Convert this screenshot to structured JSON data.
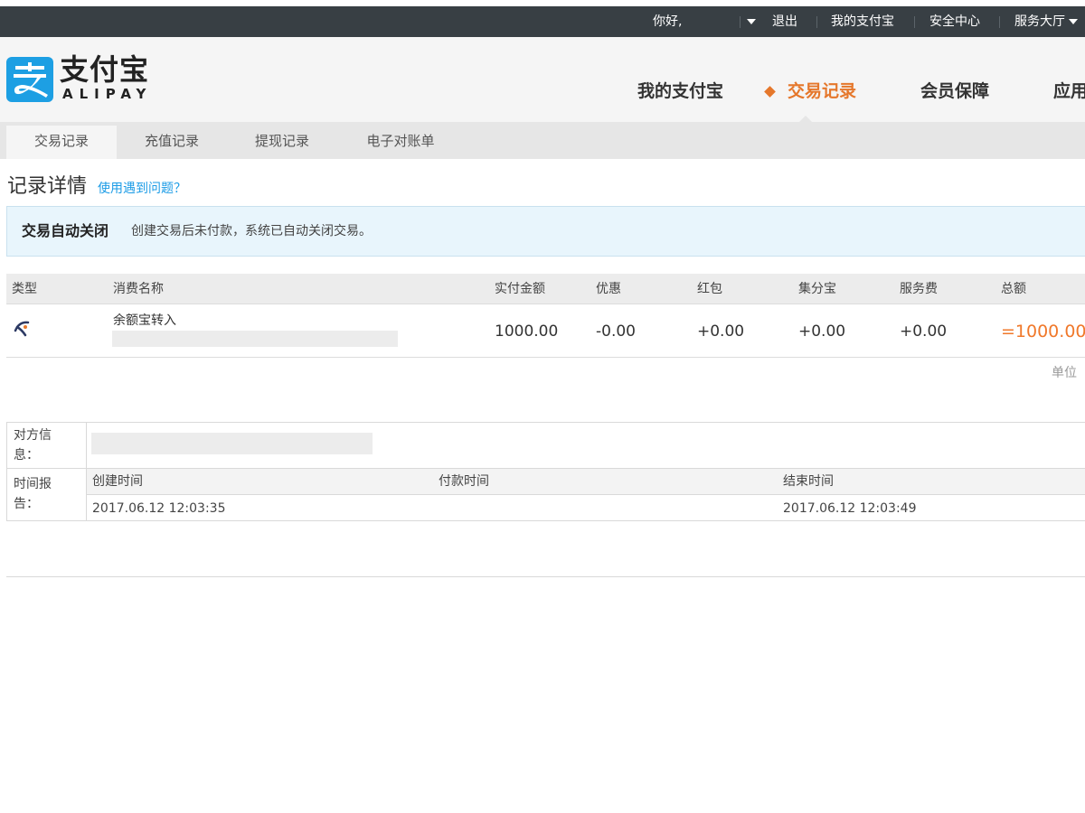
{
  "topbar": {
    "greeting": "你好,",
    "logout": "退出",
    "my_alipay": "我的支付宝",
    "security_center": "安全中心",
    "service_hall": "服务大厅"
  },
  "logo": {
    "cn": "支付宝",
    "en": "ALIPAY"
  },
  "main_nav": [
    "我的支付宝",
    "交易记录",
    "会员保障",
    "应用"
  ],
  "sub_nav": [
    "交易记录",
    "充值记录",
    "提现记录",
    "电子对账单"
  ],
  "page": {
    "title": "记录详情",
    "help_link": "使用遇到问题？"
  },
  "notice": {
    "title": "交易自动关闭",
    "text": "创建交易后未付款，系统已自动关闭交易。"
  },
  "transaction_table": {
    "headers": [
      "类型",
      "消费名称",
      "实付金额",
      "优惠",
      "红包",
      "集分宝",
      "服务费",
      "总额"
    ],
    "row": {
      "type_icon": "yuebao-icon",
      "name": "余额宝转入",
      "paid": "1000.00",
      "discount": "-0.00",
      "red_packet": "+0.00",
      "points": "+0.00",
      "service_fee": "+0.00",
      "total": "=1000.00"
    }
  },
  "unit_label": "单位",
  "counterparty": {
    "label": "对方信息："
  },
  "time_report": {
    "label": "时间报告：",
    "headers": [
      "创建时间",
      "付款时间",
      "结束时间"
    ],
    "values": [
      "2017.06.12 12:03:35",
      "",
      "2017.06.12 12:03:49"
    ]
  },
  "colors": {
    "topbar_bg": "#383f44",
    "accent_orange": "#e5772b",
    "link_blue": "#1a9be6",
    "logo_blue": "#1d9fe3",
    "notice_bg": "#e8f5fc"
  }
}
